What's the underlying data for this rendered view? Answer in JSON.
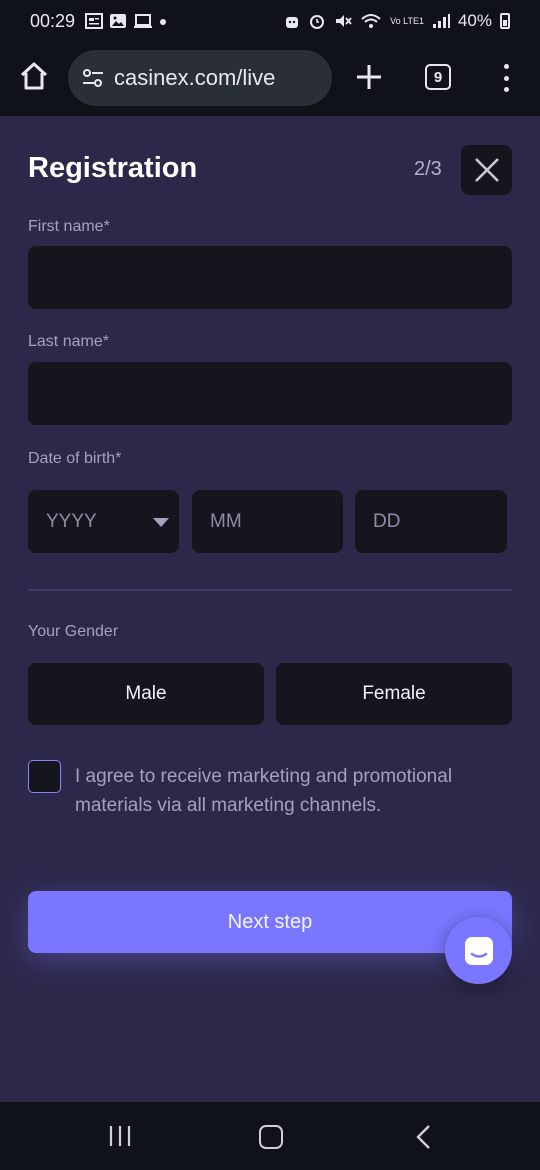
{
  "status_bar": {
    "time": "00:29",
    "battery": "40%",
    "network": "Vo LTE1"
  },
  "browser": {
    "url": "casinex.com/live",
    "tab_count": "9"
  },
  "form": {
    "title": "Registration",
    "step": "2/3",
    "first_name_label": "First name*",
    "last_name_label": "Last name*",
    "dob_label": "Date of birth*",
    "year_placeholder": "YYYY",
    "month_placeholder": "MM",
    "day_placeholder": "DD",
    "gender_label": "Your Gender",
    "gender_options": [
      "Male",
      "Female"
    ],
    "consent_text": "I agree to receive marketing and promotional materials via all marketing channels.",
    "next_label": "Next step"
  },
  "colors": {
    "accent": "#7a76ff",
    "background": "#2b2849",
    "field": "#15151e",
    "bars": "#0f1218"
  },
  "icons": [
    "home-icon",
    "site-settings-icon",
    "plus-icon",
    "tabs-icon",
    "more-menu-icon",
    "close-icon",
    "dropdown-caret-icon",
    "chat-icon",
    "recent-apps-icon",
    "home-nav-icon",
    "back-icon"
  ]
}
